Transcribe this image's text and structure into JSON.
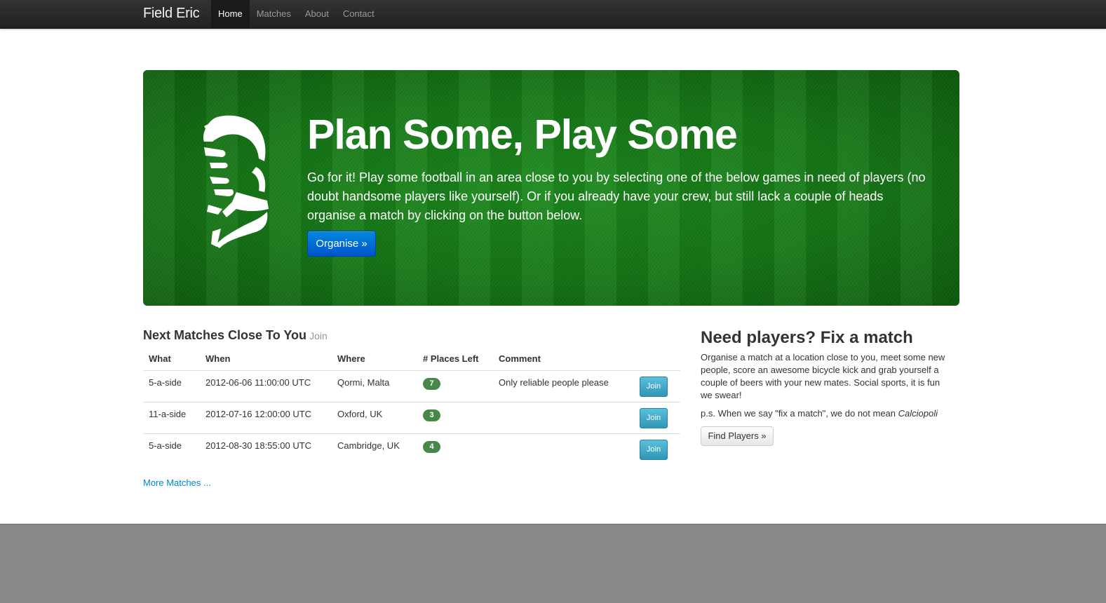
{
  "navbar": {
    "brand": "Field Eric",
    "items": [
      {
        "label": "Home",
        "active": true
      },
      {
        "label": "Matches",
        "active": false
      },
      {
        "label": "About",
        "active": false
      },
      {
        "label": "Contact",
        "active": false
      }
    ]
  },
  "hero": {
    "title": "Plan Some, Play Some",
    "text": "Go for it! Play some football in an area close to you by selecting one of the below games in need of players (no doubt handsome players like yourself). Or if you already have your crew, but still lack a couple of heads organise a match by clicking on the button below.",
    "button_label": "Organise »",
    "silhouette_icon": "footballer-silhouette-icon"
  },
  "matches": {
    "heading": "Next Matches Close To You",
    "subheading": "Join",
    "columns": [
      "What",
      "When",
      "Where",
      "# Places Left",
      "Comment"
    ],
    "rows": [
      {
        "what": "5-a-side",
        "when": "2012-06-06 11:00:00 UTC",
        "where": "Qormi, Malta",
        "places_left": "7",
        "comment": "Only reliable people please",
        "action": "Join"
      },
      {
        "what": "11-a-side",
        "when": "2012-07-16 12:00:00 UTC",
        "where": "Oxford, UK",
        "places_left": "3",
        "comment": "",
        "action": "Join"
      },
      {
        "what": "5-a-side",
        "when": "2012-08-30 18:55:00 UTC",
        "where": "Cambridge, UK",
        "places_left": "4",
        "comment": "",
        "action": "Join"
      }
    ],
    "more_link": "More Matches ..."
  },
  "sidebar": {
    "title": "Need players? Fix a match",
    "text": "Organise a match at a location close to you, meet some new people, score an awesome bicycle kick and grab yourself a couple of beers with your new mates. Social sports, it is fun we swear!",
    "ps_prefix": "p.s. When we say \"fix a match\", we do not mean ",
    "ps_emphasis": "Calciopoli",
    "button_label": "Find Players »"
  },
  "colors": {
    "navbar": "#222222",
    "hero_green": "#157815",
    "primary_button": "#0066cc",
    "badge_green": "#468847",
    "join_button": "#2f96b4",
    "link": "#0088cc",
    "footer": "#888888"
  }
}
